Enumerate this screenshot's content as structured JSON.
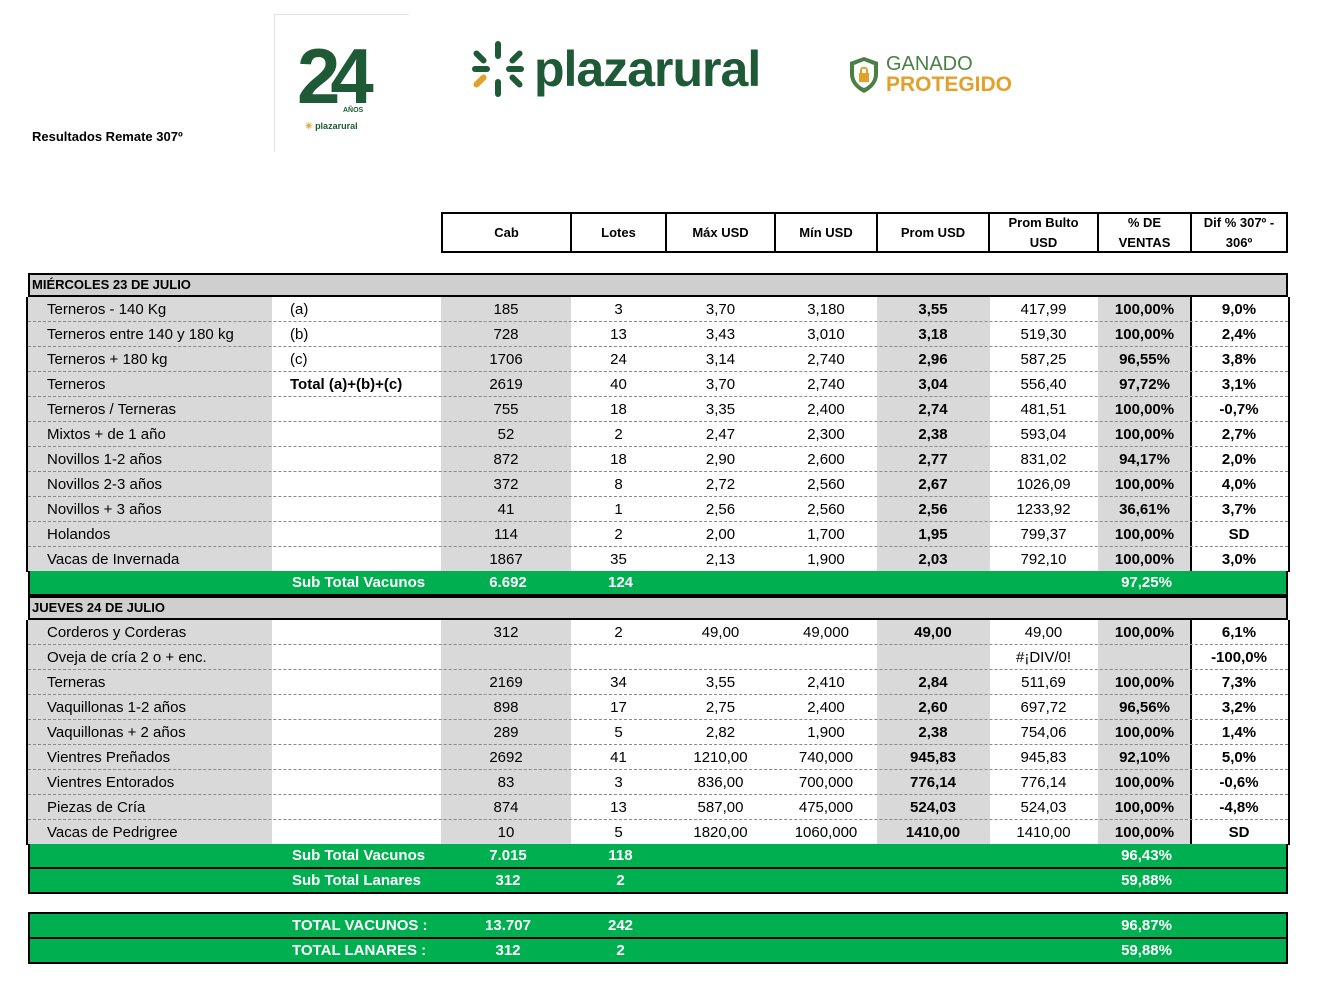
{
  "header": {
    "report_title": "Resultados Remate 307º",
    "logo_24": {
      "number": "24",
      "anos": "AÑOS",
      "brand": "plazarural"
    },
    "logo_main": "plazarural",
    "logo_ganado": {
      "line1": "GANADO",
      "line2": "PROTEGIDO"
    }
  },
  "columns": {
    "cab": "Cab",
    "lotes": "Lotes",
    "max": "Máx USD",
    "min": "Mín USD",
    "prom": "Prom USD",
    "bulto": "Prom Bulto USD",
    "ventas": "% DE VENTAS",
    "dif": "Dif % 307º - 306º"
  },
  "section1": {
    "title": "MIÉRCOLES 23 DE JULIO",
    "rows": [
      {
        "name": "Terneros - 140 Kg",
        "note": "(a)",
        "cab": "185",
        "lotes": "3",
        "max": "3,70",
        "min": "3,180",
        "prom": "3,55",
        "bulto": "417,99",
        "ventas": "100,00%",
        "dif": "9,0%"
      },
      {
        "name": "Terneros entre 140 y 180 kg",
        "note": "(b)",
        "cab": "728",
        "lotes": "13",
        "max": "3,43",
        "min": "3,010",
        "prom": "3,18",
        "bulto": "519,30",
        "ventas": "100,00%",
        "dif": "2,4%"
      },
      {
        "name": "Terneros + 180 kg",
        "note": "(c)",
        "cab": "1706",
        "lotes": "24",
        "max": "3,14",
        "min": "2,740",
        "prom": "2,96",
        "bulto": "587,25",
        "ventas": "96,55%",
        "dif": "3,8%"
      },
      {
        "name": "Terneros",
        "note": "Total (a)+(b)+(c)",
        "cab": "2619",
        "lotes": "40",
        "max": "3,70",
        "min": "2,740",
        "prom": "3,04",
        "bulto": "556,40",
        "ventas": "97,72%",
        "dif": "3,1%"
      },
      {
        "name": "Terneros / Terneras",
        "note": "",
        "cab": "755",
        "lotes": "18",
        "max": "3,35",
        "min": "2,400",
        "prom": "2,74",
        "bulto": "481,51",
        "ventas": "100,00%",
        "dif": "-0,7%"
      },
      {
        "name": "Mixtos + de 1 año",
        "note": "",
        "cab": "52",
        "lotes": "2",
        "max": "2,47",
        "min": "2,300",
        "prom": "2,38",
        "bulto": "593,04",
        "ventas": "100,00%",
        "dif": "2,7%"
      },
      {
        "name": "Novillos 1-2 años",
        "note": "",
        "cab": "872",
        "lotes": "18",
        "max": "2,90",
        "min": "2,600",
        "prom": "2,77",
        "bulto": "831,02",
        "ventas": "94,17%",
        "dif": "2,0%"
      },
      {
        "name": "Novillos 2-3 años",
        "note": "",
        "cab": "372",
        "lotes": "8",
        "max": "2,72",
        "min": "2,560",
        "prom": "2,67",
        "bulto": "1026,09",
        "ventas": "100,00%",
        "dif": "4,0%"
      },
      {
        "name": "Novillos + 3 años",
        "note": "",
        "cab": "41",
        "lotes": "1",
        "max": "2,56",
        "min": "2,560",
        "prom": "2,56",
        "bulto": "1233,92",
        "ventas": "36,61%",
        "dif": "3,7%"
      },
      {
        "name": "Holandos",
        "note": "",
        "cab": "114",
        "lotes": "2",
        "max": "2,00",
        "min": "1,700",
        "prom": "1,95",
        "bulto": "799,37",
        "ventas": "100,00%",
        "dif": "SD"
      },
      {
        "name": "Vacas de Invernada",
        "note": "",
        "cab": "1867",
        "lotes": "35",
        "max": "2,13",
        "min": "1,900",
        "prom": "2,03",
        "bulto": "792,10",
        "ventas": "100,00%",
        "dif": "3,0%"
      }
    ],
    "subtotal": {
      "label": "Sub Total Vacunos",
      "cab": "6.692",
      "lotes": "124",
      "ventas": "97,25%"
    }
  },
  "section2": {
    "title": "JUEVES 24 DE JULIO",
    "rows": [
      {
        "name": "Corderos y Corderas",
        "note": "",
        "cab": "312",
        "lotes": "2",
        "max": "49,00",
        "min": "49,000",
        "prom": "49,00",
        "bulto": "49,00",
        "ventas": "100,00%",
        "dif": "6,1%"
      },
      {
        "name": "Oveja de cría 2 o + enc.",
        "note": "",
        "cab": "",
        "lotes": "",
        "max": "",
        "min": "",
        "prom": "",
        "bulto": "#¡DIV/0!",
        "ventas": "",
        "dif": "-100,0%"
      },
      {
        "name": "Terneras",
        "note": "",
        "cab": "2169",
        "lotes": "34",
        "max": "3,55",
        "min": "2,410",
        "prom": "2,84",
        "bulto": "511,69",
        "ventas": "100,00%",
        "dif": "7,3%"
      },
      {
        "name": "Vaquillonas 1-2 años",
        "note": "",
        "cab": "898",
        "lotes": "17",
        "max": "2,75",
        "min": "2,400",
        "prom": "2,60",
        "bulto": "697,72",
        "ventas": "96,56%",
        "dif": "3,2%"
      },
      {
        "name": "Vaquillonas + 2 años",
        "note": "",
        "cab": "289",
        "lotes": "5",
        "max": "2,82",
        "min": "1,900",
        "prom": "2,38",
        "bulto": "754,06",
        "ventas": "100,00%",
        "dif": "1,4%"
      },
      {
        "name": "Vientres Preñados",
        "note": "",
        "cab": "2692",
        "lotes": "41",
        "max": "1210,00",
        "min": "740,000",
        "prom": "945,83",
        "bulto": "945,83",
        "ventas": "92,10%",
        "dif": "5,0%"
      },
      {
        "name": "Vientres Entorados",
        "note": "",
        "cab": "83",
        "lotes": "3",
        "max": "836,00",
        "min": "700,000",
        "prom": "776,14",
        "bulto": "776,14",
        "ventas": "100,00%",
        "dif": "-0,6%"
      },
      {
        "name": "Piezas de Cría",
        "note": "",
        "cab": "874",
        "lotes": "13",
        "max": "587,00",
        "min": "475,000",
        "prom": "524,03",
        "bulto": "524,03",
        "ventas": "100,00%",
        "dif": "-4,8%"
      },
      {
        "name": "Vacas de Pedrigree",
        "note": "",
        "cab": "10",
        "lotes": "5",
        "max": "1820,00",
        "min": "1060,000",
        "prom": "1410,00",
        "bulto": "1410,00",
        "ventas": "100,00%",
        "dif": "SD"
      }
    ],
    "subtotal_vacunos": {
      "label": "Sub Total Vacunos",
      "cab": "7.015",
      "lotes": "118",
      "ventas": "96,43%"
    },
    "subtotal_lanares": {
      "label": "Sub Total Lanares",
      "cab": "312",
      "lotes": "2",
      "ventas": "59,88%"
    }
  },
  "totals": {
    "vacunos": {
      "label": "TOTAL VACUNOS :",
      "cab": "13.707",
      "lotes": "242",
      "ventas": "96,87%"
    },
    "lanares": {
      "label": "TOTAL LANARES :",
      "cab": "312",
      "lotes": "2",
      "ventas": "59,88%"
    }
  },
  "colors": {
    "green": "#00b050",
    "gray": "#d9d9d9",
    "section": "#cfcfcf",
    "brand": "#1e5a36",
    "accent": "#e2a12a"
  }
}
